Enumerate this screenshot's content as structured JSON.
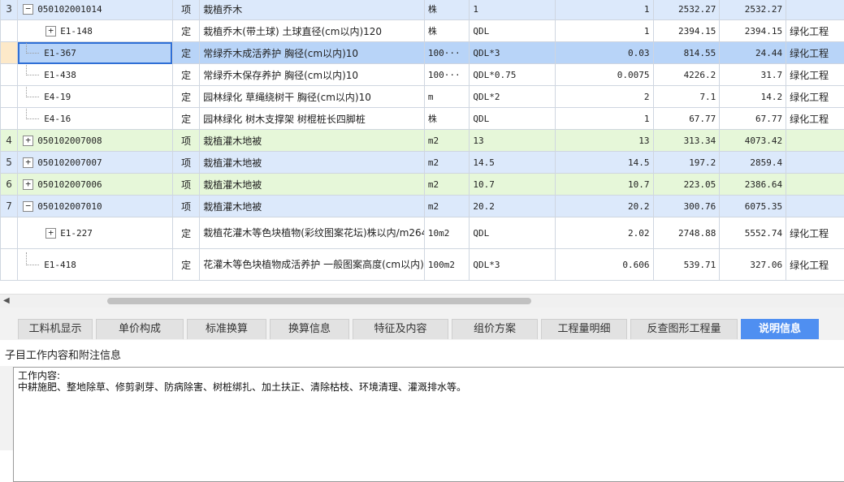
{
  "grid": {
    "rows": [
      {
        "no": "3",
        "toggle": "−",
        "tree": false,
        "code": "050102001014",
        "type": "项",
        "name": "栽植乔木",
        "unit": "株",
        "expr": "1",
        "qty": "1",
        "price": "2532.27",
        "total": "2532.27",
        "spec": "",
        "kind": "qd"
      },
      {
        "no": "",
        "toggle": "+",
        "tree": false,
        "code": "E1-148",
        "type": "定",
        "name": "栽植乔木(带土球) 土球直径(cm以内)120",
        "unit": "株",
        "expr": "QDL",
        "qty": "1",
        "price": "2394.15",
        "total": "2394.15",
        "spec": "绿化工程",
        "kind": "de"
      },
      {
        "no": "",
        "toggle": "",
        "tree": true,
        "code": "E1-367",
        "type": "定",
        "name": "常绿乔木成活养护 胸径(cm以内)10",
        "unit": "100···",
        "expr": "QDL*3",
        "qty": "0.03",
        "price": "814.55",
        "total": "24.44",
        "spec": "绿化工程",
        "kind": "sel"
      },
      {
        "no": "",
        "toggle": "",
        "tree": true,
        "code": "E1-438",
        "type": "定",
        "name": "常绿乔木保存养护 胸径(cm以内)10",
        "unit": "100···",
        "expr": "QDL*0.75",
        "qty": "0.0075",
        "price": "4226.2",
        "total": "31.7",
        "spec": "绿化工程",
        "kind": "de"
      },
      {
        "no": "",
        "toggle": "",
        "tree": true,
        "code": "E4-19",
        "type": "定",
        "name": "园林绿化 草绳绕树干 胸径(cm以内)10",
        "unit": "m",
        "expr": "QDL*2",
        "qty": "2",
        "price": "7.1",
        "total": "14.2",
        "spec": "绿化工程",
        "kind": "de"
      },
      {
        "no": "",
        "toggle": "",
        "tree": true,
        "code": "E4-16",
        "type": "定",
        "name": "园林绿化 树木支撑架 树棍桩长四脚桩",
        "unit": "株",
        "expr": "QDL",
        "qty": "1",
        "price": "67.77",
        "total": "67.77",
        "spec": "绿化工程",
        "kind": "de"
      },
      {
        "no": "4",
        "toggle": "+",
        "tree": false,
        "code": "050102007008",
        "type": "项",
        "name": "栽植灌木地被",
        "unit": "m2",
        "expr": "13",
        "qty": "13",
        "price": "313.34",
        "total": "4073.42",
        "spec": "",
        "kind": "qdg"
      },
      {
        "no": "5",
        "toggle": "+",
        "tree": false,
        "code": "050102007007",
        "type": "项",
        "name": "栽植灌木地被",
        "unit": "m2",
        "expr": "14.5",
        "qty": "14.5",
        "price": "197.2",
        "total": "2859.4",
        "spec": "",
        "kind": "qd"
      },
      {
        "no": "6",
        "toggle": "+",
        "tree": false,
        "code": "050102007006",
        "type": "项",
        "name": "栽植灌木地被",
        "unit": "m2",
        "expr": "10.7",
        "qty": "10.7",
        "price": "223.05",
        "total": "2386.64",
        "spec": "",
        "kind": "qdg"
      },
      {
        "no": "7",
        "toggle": "−",
        "tree": false,
        "code": "050102007010",
        "type": "项",
        "name": "栽植灌木地被",
        "unit": "m2",
        "expr": "20.2",
        "qty": "20.2",
        "price": "300.76",
        "total": "6075.35",
        "spec": "",
        "kind": "qd"
      },
      {
        "no": "",
        "toggle": "+",
        "tree": false,
        "code": "E1-227",
        "type": "定",
        "name": "栽植花灌木等色块植物(彩纹图案花坛)株以内/m264",
        "unit": "10m2",
        "expr": "QDL",
        "qty": "2.02",
        "price": "2748.88",
        "total": "5552.74",
        "spec": "绿化工程",
        "kind": "de2"
      },
      {
        "no": "",
        "toggle": "",
        "tree": true,
        "code": "E1-418",
        "type": "定",
        "name": "花灌木等色块植物成活养护 一般图案高度(cm以内)",
        "unit": "100m2",
        "expr": "QDL*3",
        "qty": "0.606",
        "price": "539.71",
        "total": "327.06",
        "spec": "绿化工程",
        "kind": "de2"
      }
    ]
  },
  "scrollbar": {
    "left_arrow": "◀"
  },
  "tabs": [
    {
      "label": "工料机显示",
      "active": false
    },
    {
      "label": "单价构成",
      "active": false
    },
    {
      "label": "标准换算",
      "active": false
    },
    {
      "label": "换算信息",
      "active": false
    },
    {
      "label": "特征及内容",
      "active": false
    },
    {
      "label": "组价方案",
      "active": false
    },
    {
      "label": "工程量明细",
      "active": false
    },
    {
      "label": "反查图形工程量",
      "active": false
    },
    {
      "label": "说明信息",
      "active": true
    }
  ],
  "panel": {
    "title": "子目工作内容和附注信息",
    "content": "工作内容:\n中耕施肥、整地除草、修剪剥芽、防病除害、树桩绑扎、加土扶正、清除枯枝、环境清理、灌溉排水等。"
  }
}
